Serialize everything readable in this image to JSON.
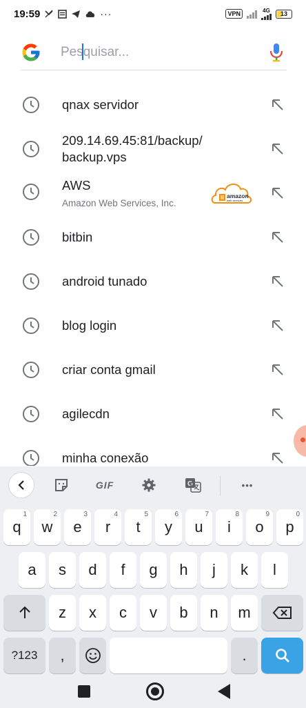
{
  "status_bar": {
    "time": "19:59",
    "vpn_label": "VPN",
    "network_label": "4G",
    "battery_level": "13"
  },
  "search": {
    "placeholder": "Pesquisar...",
    "value": ""
  },
  "suggestions": [
    {
      "text": "qnax servidor"
    },
    {
      "text": "209.14.69.45:81/backup/",
      "text2": "backup.vps"
    },
    {
      "text": "AWS",
      "subtitle": "Amazon Web Services, Inc.",
      "logo_text": "amazon",
      "logo_subtext": "web services"
    },
    {
      "text": "bitbin"
    },
    {
      "text": "android tunado"
    },
    {
      "text": "blog login"
    },
    {
      "text": "criar conta gmail"
    },
    {
      "text": "agilecdn"
    },
    {
      "text": "minha conexão"
    }
  ],
  "keyboard": {
    "toolbar": {
      "gif": "GIF",
      "more": "•••"
    },
    "row1": [
      {
        "k": "q",
        "n": "1"
      },
      {
        "k": "w",
        "n": "2"
      },
      {
        "k": "e",
        "n": "3"
      },
      {
        "k": "r",
        "n": "4"
      },
      {
        "k": "t",
        "n": "5"
      },
      {
        "k": "y",
        "n": "6"
      },
      {
        "k": "u",
        "n": "7"
      },
      {
        "k": "i",
        "n": "8"
      },
      {
        "k": "o",
        "n": "9"
      },
      {
        "k": "p",
        "n": "0"
      }
    ],
    "row2": [
      "a",
      "s",
      "d",
      "f",
      "g",
      "h",
      "j",
      "k",
      "l"
    ],
    "row3": [
      "z",
      "x",
      "c",
      "v",
      "b",
      "n",
      "m"
    ],
    "symbols_label": "?123",
    "comma_label": ",",
    "period_label": "."
  },
  "colors": {
    "accent": "#1a73e8",
    "search_key": "#3aa3e6",
    "keyboard_bg": "#edeff2"
  }
}
